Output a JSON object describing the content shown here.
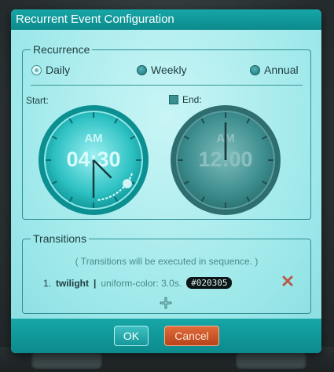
{
  "dialog": {
    "title": "Recurrent Event Configuration"
  },
  "recurrence": {
    "legend": "Recurrence",
    "options": [
      {
        "label": "Daily",
        "selected": true
      },
      {
        "label": "Weekly",
        "selected": false
      },
      {
        "label": "Annual",
        "selected": false
      }
    ],
    "start_label": "Start:",
    "end_label": "End:",
    "end_enabled": false,
    "start_clock": {
      "meridiem": "AM",
      "time": "04:30",
      "hour": 4,
      "minute": 30
    },
    "end_clock": {
      "meridiem": "AM",
      "time": "12:00",
      "hour": 12,
      "minute": 0
    }
  },
  "transitions": {
    "legend": "Transitions",
    "note": "( Transitions will be executed in sequence. )",
    "items": [
      {
        "index": "1.",
        "name": "twilight",
        "separator": "|",
        "detail": "uniform-color: 3.0s.",
        "color_label": "#020305"
      }
    ]
  },
  "footer": {
    "ok_label": "OK",
    "cancel_label": "Cancel"
  },
  "colors": {
    "accent": "#0f9597",
    "cancel": "#c9522a",
    "remove": "#b85a4a"
  }
}
